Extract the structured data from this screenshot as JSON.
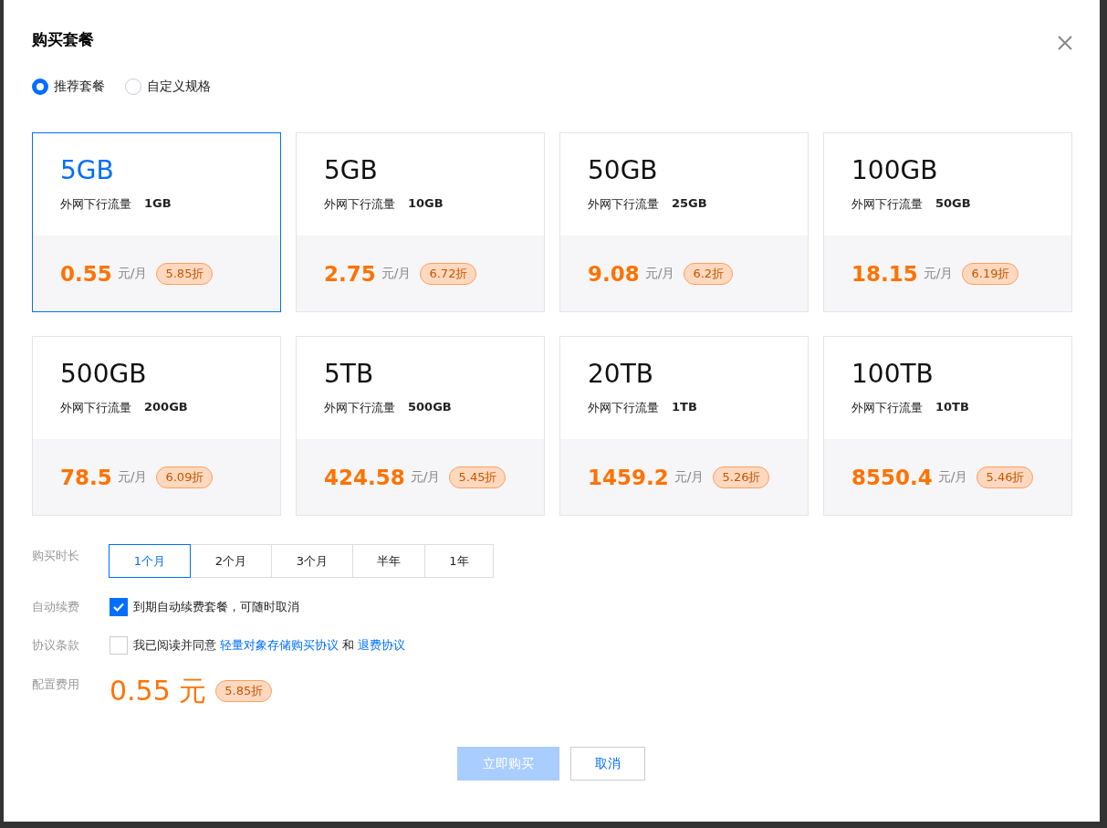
{
  "dialog": {
    "title": "购买套餐"
  },
  "modes": [
    {
      "label": "推荐套餐",
      "selected": true
    },
    {
      "label": "自定义规格",
      "selected": false
    }
  ],
  "packages": [
    {
      "size": "5GB",
      "traffic_label": "外网下行流量",
      "traffic": "1GB",
      "price": "0.55",
      "unit": "元/月",
      "discount": "5.85折",
      "selected": true
    },
    {
      "size": "5GB",
      "traffic_label": "外网下行流量",
      "traffic": "10GB",
      "price": "2.75",
      "unit": "元/月",
      "discount": "6.72折",
      "selected": false
    },
    {
      "size": "50GB",
      "traffic_label": "外网下行流量",
      "traffic": "25GB",
      "price": "9.08",
      "unit": "元/月",
      "discount": "6.2折",
      "selected": false
    },
    {
      "size": "100GB",
      "traffic_label": "外网下行流量",
      "traffic": "50GB",
      "price": "18.15",
      "unit": "元/月",
      "discount": "6.19折",
      "selected": false
    },
    {
      "size": "500GB",
      "traffic_label": "外网下行流量",
      "traffic": "200GB",
      "price": "78.5",
      "unit": "元/月",
      "discount": "6.09折",
      "selected": false
    },
    {
      "size": "5TB",
      "traffic_label": "外网下行流量",
      "traffic": "500GB",
      "price": "424.58",
      "unit": "元/月",
      "discount": "5.45折",
      "selected": false
    },
    {
      "size": "20TB",
      "traffic_label": "外网下行流量",
      "traffic": "1TB",
      "price": "1459.2",
      "unit": "元/月",
      "discount": "5.26折",
      "selected": false
    },
    {
      "size": "100TB",
      "traffic_label": "外网下行流量",
      "traffic": "10TB",
      "price": "8550.4",
      "unit": "元/月",
      "discount": "5.46折",
      "selected": false
    }
  ],
  "duration": {
    "label": "购买时长",
    "options": [
      {
        "label": "1个月",
        "selected": true
      },
      {
        "label": "2个月",
        "selected": false
      },
      {
        "label": "3个月",
        "selected": false
      },
      {
        "label": "半年",
        "selected": false
      },
      {
        "label": "1年",
        "selected": false
      }
    ]
  },
  "auto_renew": {
    "label": "自动续费",
    "text": "到期自动续费套餐，可随时取消",
    "checked": true
  },
  "agreement": {
    "label": "协议条款",
    "text": "我已阅读并同意",
    "link1": "轻量对象存储购买协议",
    "and": "和",
    "link2": "退费协议",
    "checked": false
  },
  "cost": {
    "label": "配置费用",
    "amount": "0.55 元",
    "discount": "5.85折"
  },
  "buttons": [
    {
      "label": "立即购买",
      "kind": "primary",
      "disabled": true
    },
    {
      "label": "取消",
      "kind": "secondary",
      "disabled": false
    }
  ]
}
